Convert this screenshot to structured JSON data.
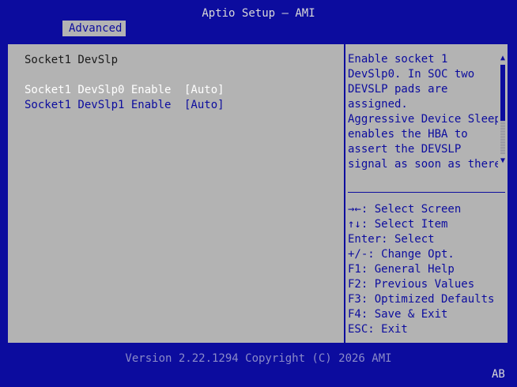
{
  "header": {
    "title": "Aptio Setup – AMI",
    "tabs": [
      {
        "label": "Advanced"
      }
    ]
  },
  "left_pane": {
    "section_title": "Socket1 DevSlp",
    "options": [
      {
        "label": "Socket1 DevSlp0 Enable",
        "value": "[Auto]",
        "selected": true
      },
      {
        "label": "Socket1 DevSlp1 Enable",
        "value": "[Auto]",
        "selected": false
      }
    ]
  },
  "help": {
    "lines": [
      "Enable socket 1",
      "DevSlp0. In SOC two",
      "DEVSLP pads are",
      "assigned.",
      "Aggressive Device Sleep",
      "enables the HBA to",
      "assert the DEVSLP",
      "signal as soon as there"
    ],
    "scroll": {
      "up_glyph": "▲",
      "down_glyph": "▼",
      "thumb_fraction": 0.62
    }
  },
  "keys": [
    "→←: Select Screen",
    "↑↓: Select Item",
    "Enter: Select",
    "+/-: Change Opt.",
    "F1: General Help",
    "F2: Previous Values",
    "F3: Optimized Defaults",
    "F4: Save & Exit",
    "ESC: Exit"
  ],
  "footer": {
    "version": "Version 2.22.1294 Copyright (C) 2026 AMI",
    "badge": "AB"
  },
  "colors": {
    "background_blue": "#0c0c9e",
    "panel_gray": "#b3b3b3",
    "text_white": "#ffffff",
    "text_dark": "#1a1a1a"
  }
}
